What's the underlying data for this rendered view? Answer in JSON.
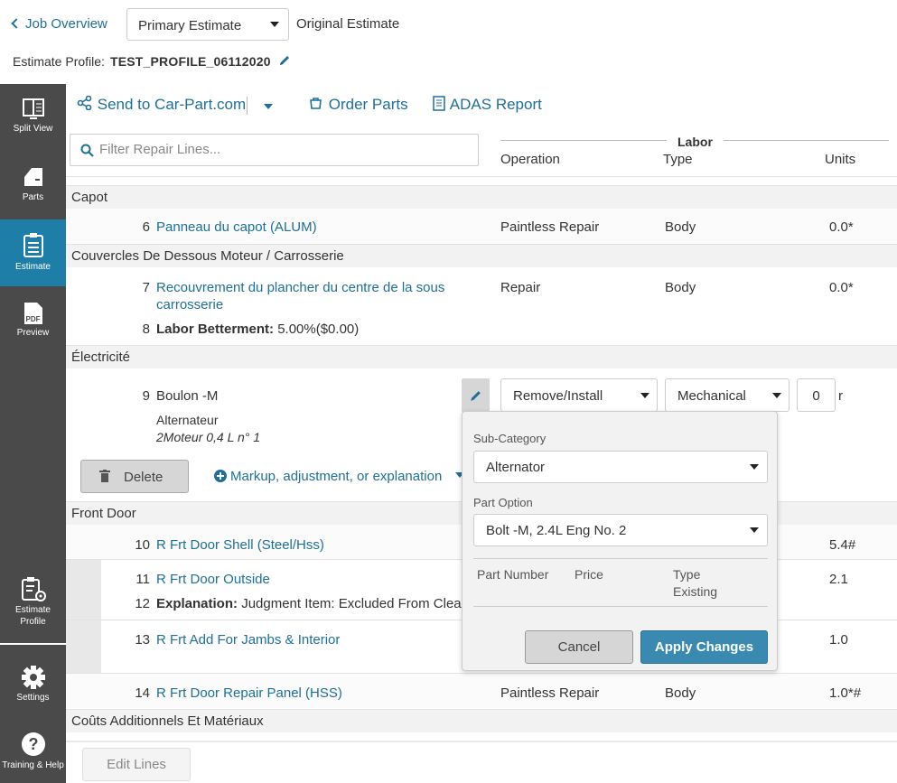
{
  "header": {
    "back_label": "Job Overview",
    "estimate_select": "Primary Estimate",
    "estimate_name": "Original Estimate",
    "profile_label": "Estimate Profile:",
    "profile_value": "TEST_PROFILE_06112020"
  },
  "sidebar": {
    "items": [
      {
        "label": "Split View"
      },
      {
        "label": "Parts"
      },
      {
        "label": "Estimate"
      },
      {
        "label": "PDF",
        "label2": "Preview"
      },
      {
        "label": "Estimate",
        "label2": "Profile"
      },
      {
        "label": "Settings"
      },
      {
        "label": "Training & Help"
      }
    ]
  },
  "toolbar": {
    "send": "Send to Car-Part.com",
    "order": "Order Parts",
    "adas": "ADAS Report"
  },
  "filter": {
    "placeholder": "Filter Repair Lines..."
  },
  "columns": {
    "labor": "Labor",
    "operation": "Operation",
    "type": "Type",
    "units": "Units"
  },
  "groups": {
    "capot": "Capot",
    "couvercles": "Couvercles De Dessous Moteur / Carrosserie",
    "electricite": "Électricité",
    "front_door": "Front Door",
    "couts": "Coûts Additionnels Et Matériaux"
  },
  "lines": {
    "l6": {
      "num": "6",
      "desc": "Panneau du capot (ALUM)",
      "op": "Paintless Repair",
      "type": "Body",
      "units": "0.0*"
    },
    "l7": {
      "num": "7",
      "desc1": "Recouvrement du plancher du centre de la sous",
      "desc2": "carrosserie",
      "op": "Repair",
      "type": "Body",
      "units": "0.0*"
    },
    "l8": {
      "num": "8",
      "label": "Labor Betterment:",
      "value": "5.00%($0.00)"
    },
    "l9": {
      "num": "9",
      "desc": "Boulon -M",
      "sub": "Alternateur",
      "sub2": "2Moteur 0,4 L n° 1",
      "op": "Remove/Install",
      "type": "Mechanical",
      "units": "0",
      "unit_suffix": "r"
    },
    "l10": {
      "num": "10",
      "desc": "R Frt Door Shell (Steel/Hss)",
      "units": "5.4#"
    },
    "l11": {
      "num": "11",
      "desc": "R Frt Door Outside",
      "units": "2.1"
    },
    "l12": {
      "num": "12",
      "label": "Explanation:",
      "value": "Judgment Item: Excluded From Clear C"
    },
    "l13": {
      "num": "13",
      "desc": "R Frt Add For Jambs & Interior",
      "units": "1.0"
    },
    "l14": {
      "num": "14",
      "desc": "R Frt Door Repair Panel (HSS)",
      "op": "Paintless Repair",
      "type": "Body",
      "units": "1.0*#"
    }
  },
  "line_actions": {
    "delete": "Delete",
    "markup": "Markup, adjustment, or explanation"
  },
  "popup": {
    "sub_category_label": "Sub-Category",
    "sub_category_value": "Alternator",
    "part_option_label": "Part Option",
    "part_option_value": "Bolt -M, 2.4L Eng No. 2",
    "col_part_number": "Part Number",
    "col_price": "Price",
    "col_type": "Type",
    "col_type_value": "Existing",
    "cancel": "Cancel",
    "apply": "Apply Changes"
  },
  "footer": {
    "edit_lines": "Edit Lines"
  },
  "colors": {
    "accent": "#1f7ea7",
    "link": "#1f6f97",
    "sidebar": "#4a4a4a",
    "apply": "#3a89b0"
  }
}
